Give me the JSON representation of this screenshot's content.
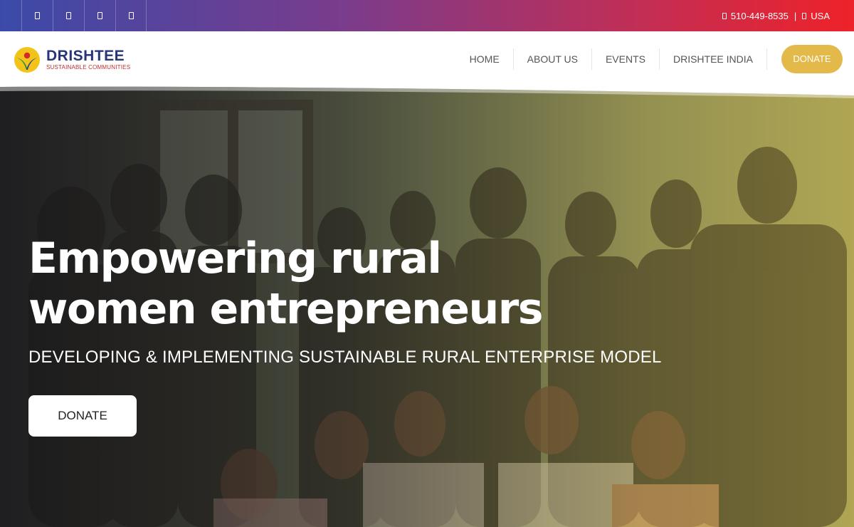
{
  "topbar": {
    "social_icons": [
      "facebook-icon",
      "instagram-icon",
      "twitter-icon",
      "linkedin-icon"
    ],
    "phone": "510-449-8535",
    "separator": "|",
    "region": "USA"
  },
  "brand": {
    "name": "DRISHTEE",
    "tagline": "SUSTAINABLE COMMUNITIES"
  },
  "nav": {
    "items": [
      "HOME",
      "ABOUT US",
      "EVENTS",
      "DRISHTEE INDIA"
    ],
    "donate_label": "DONATE"
  },
  "hero": {
    "title_line1": "Empowering rural",
    "title_line2": "women entrepreneurs",
    "subtitle": "DEVELOPING & IMPLEMENTING SUSTAINABLE RURAL ENTERPRISE MODEL",
    "cta_label": "DONATE"
  },
  "colors": {
    "brand_navy": "#27367a",
    "brand_red": "#c22e2e",
    "donate_gold": "#e3b94a",
    "topbar_start": "#3b4aa8",
    "topbar_end": "#ee2229"
  }
}
